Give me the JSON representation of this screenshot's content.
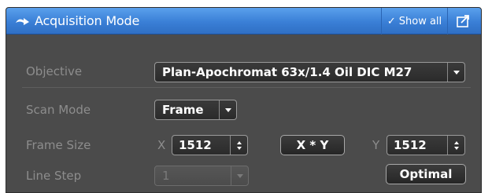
{
  "header": {
    "title": "Acquisition Mode",
    "title_icon": "collapse-arrow-icon",
    "show_all_label": "Show all",
    "show_all_icon": "check-icon",
    "undock_icon": "undock-icon"
  },
  "fields": {
    "objective": {
      "label": "Objective",
      "value": "Plan-Apochromat 63x/1.4 Oil DIC M27"
    },
    "scan_mode": {
      "label": "Scan Mode",
      "value": "Frame"
    },
    "frame_size": {
      "label": "Frame Size",
      "x_label": "X",
      "x_value": "1512",
      "xy_button": "X * Y",
      "y_label": "Y",
      "y_value": "1512"
    },
    "line_step": {
      "label": "Line Step",
      "value": "1",
      "disabled": true,
      "optimal_button": "Optimal"
    }
  },
  "colors": {
    "title_bar": "#3a7fd6",
    "panel_bg": "#4b4b4b",
    "label_text": "#8d8d8d",
    "control_bg": "#2b2b2b"
  }
}
